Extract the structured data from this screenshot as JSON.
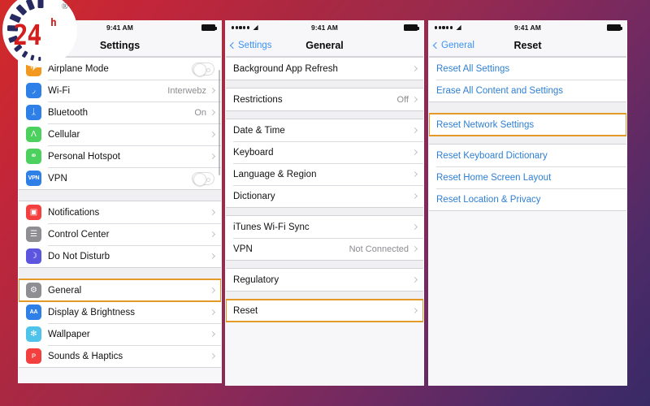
{
  "theme": {
    "accent_highlight": "#e39a28",
    "link_blue": "#2f7fd4",
    "nav_blue": "#3b93f7",
    "bg_start": "#d32a28",
    "bg_mid": "#86295a",
    "bg_end": "#382a66"
  },
  "logo": {
    "text_main": "24",
    "text_sup": "h",
    "trademark": "®"
  },
  "status_bar": {
    "time": "9:41 AM",
    "wifi_icon": "wifi-icon",
    "battery_icon": "battery-icon",
    "signal_dots": 5
  },
  "screen1": {
    "title": "Settings",
    "groups": [
      {
        "rows": [
          {
            "label": "Airplane Mode",
            "icon": "airplane-icon",
            "icon_color": "#f2981f",
            "glyph": "✈",
            "control": "toggle-off"
          },
          {
            "label": "Wi-Fi",
            "icon": "wifi-icon",
            "icon_color": "#2f7fe8",
            "glyph": "◞",
            "value": "Interwebz",
            "control": "chevron"
          },
          {
            "label": "Bluetooth",
            "icon": "bluetooth-icon",
            "icon_color": "#2f7fe8",
            "glyph": "ᛣ",
            "value": "On",
            "control": "chevron"
          },
          {
            "label": "Cellular",
            "icon": "cellular-icon",
            "icon_color": "#4cd05e",
            "glyph": "Ʌ",
            "control": "chevron"
          },
          {
            "label": "Personal Hotspot",
            "icon": "hotspot-icon",
            "icon_color": "#4cd05e",
            "glyph": "⚭",
            "control": "chevron"
          },
          {
            "label": "VPN",
            "icon": "vpn-icon",
            "icon_color": "#2f7fe8",
            "glyph": "VPN",
            "control": "toggle-off"
          }
        ]
      },
      {
        "rows": [
          {
            "label": "Notifications",
            "icon": "notifications-icon",
            "icon_color": "#f43f3f",
            "glyph": "▣",
            "control": "chevron"
          },
          {
            "label": "Control Center",
            "icon": "control-center-icon",
            "icon_color": "#8e8e93",
            "glyph": "☰",
            "control": "chevron"
          },
          {
            "label": "Do Not Disturb",
            "icon": "do-not-disturb-icon",
            "icon_color": "#5c55e0",
            "glyph": "☽",
            "control": "chevron"
          }
        ]
      },
      {
        "rows": [
          {
            "label": "General",
            "icon": "gear-icon",
            "icon_color": "#8e8e93",
            "glyph": "⚙",
            "control": "chevron",
            "highlighted": true
          },
          {
            "label": "Display & Brightness",
            "icon": "display-brightness-icon",
            "icon_color": "#2f7fe8",
            "glyph": "AA",
            "control": "chevron"
          },
          {
            "label": "Wallpaper",
            "icon": "wallpaper-icon",
            "icon_color": "#4fc3ea",
            "glyph": "✻",
            "control": "chevron"
          },
          {
            "label": "Sounds & Haptics",
            "icon": "sounds-haptics-icon",
            "icon_color": "#f43f3f",
            "glyph": "ᴘ",
            "control": "chevron"
          }
        ]
      }
    ]
  },
  "screen2": {
    "title": "General",
    "back_label": "Settings",
    "groups": [
      {
        "rows": [
          {
            "label": "Background App Refresh",
            "control": "chevron"
          }
        ]
      },
      {
        "rows": [
          {
            "label": "Restrictions",
            "value": "Off",
            "control": "chevron"
          }
        ]
      },
      {
        "rows": [
          {
            "label": "Date & Time",
            "control": "chevron"
          },
          {
            "label": "Keyboard",
            "control": "chevron"
          },
          {
            "label": "Language & Region",
            "control": "chevron"
          },
          {
            "label": "Dictionary",
            "control": "chevron"
          }
        ]
      },
      {
        "rows": [
          {
            "label": "iTunes Wi-Fi Sync",
            "control": "chevron"
          },
          {
            "label": "VPN",
            "value": "Not Connected",
            "control": "chevron"
          }
        ]
      },
      {
        "rows": [
          {
            "label": "Regulatory",
            "control": "chevron"
          }
        ]
      },
      {
        "rows": [
          {
            "label": "Reset",
            "control": "chevron",
            "highlighted": true
          }
        ]
      }
    ]
  },
  "screen3": {
    "title": "Reset",
    "back_label": "General",
    "groups": [
      {
        "rows": [
          {
            "label": "Reset All Settings",
            "style": "link"
          },
          {
            "label": "Erase All Content and Settings",
            "style": "link"
          }
        ]
      },
      {
        "rows": [
          {
            "label": "Reset Network Settings",
            "style": "link",
            "highlighted": true
          }
        ]
      },
      {
        "rows": [
          {
            "label": "Reset Keyboard Dictionary",
            "style": "link"
          },
          {
            "label": "Reset Home Screen Layout",
            "style": "link"
          },
          {
            "label": "Reset Location & Privacy",
            "style": "link"
          }
        ]
      }
    ]
  }
}
